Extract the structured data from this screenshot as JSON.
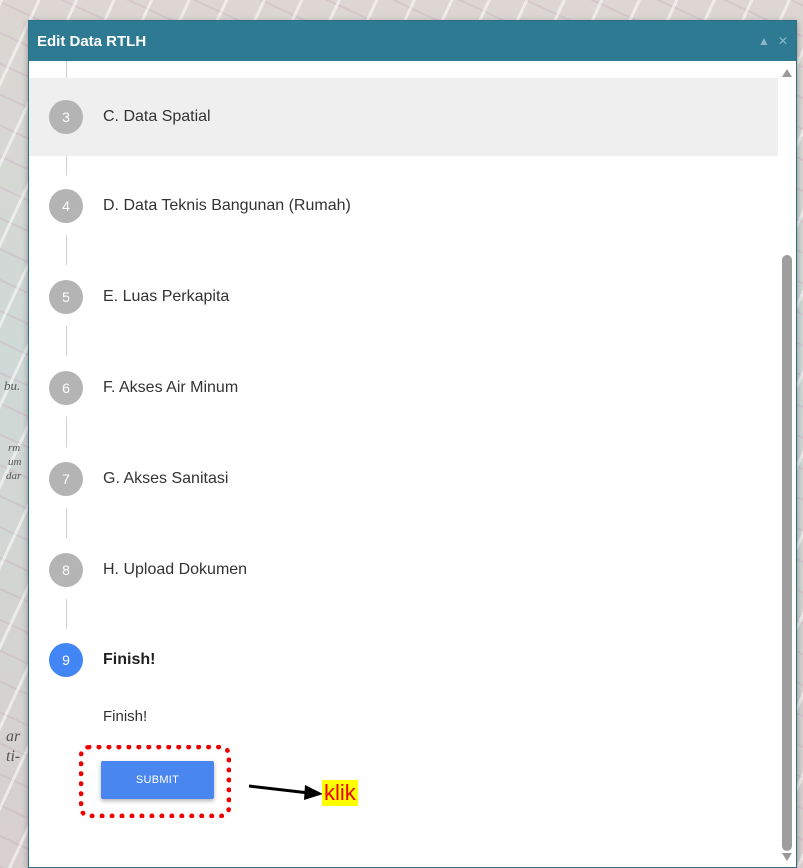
{
  "dialog": {
    "title": "Edit Data RTLH",
    "controls": {
      "collapse": "▲",
      "close": "✕"
    }
  },
  "map": {
    "labels": [
      "bu.",
      "rm",
      "um",
      "dar",
      "ar",
      "ti-"
    ]
  },
  "steps": [
    {
      "number": "3",
      "label": "C. Data Spatial"
    },
    {
      "number": "4",
      "label": "D. Data Teknis Bangunan (Rumah)"
    },
    {
      "number": "5",
      "label": "E. Luas Perkapita"
    },
    {
      "number": "6",
      "label": "F. Akses Air Minum"
    },
    {
      "number": "7",
      "label": "G. Akses Sanitasi"
    },
    {
      "number": "8",
      "label": "H. Upload Dokumen"
    },
    {
      "number": "9",
      "label": "Finish!"
    }
  ],
  "finish": {
    "text": "Finish!",
    "submit_label": "SUBMIT"
  },
  "annotation": {
    "label": "klik",
    "highlight_color": "#ee0000",
    "label_bg": "#ffff00"
  },
  "colors": {
    "header": "#2e7a93",
    "active_step": "#4285f4",
    "inactive_step": "#b4b4b4",
    "submit": "#4a86f0"
  }
}
